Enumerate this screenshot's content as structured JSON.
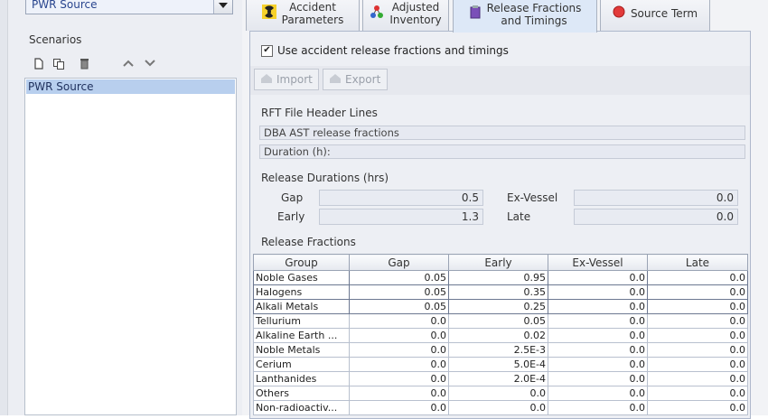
{
  "left_panel": {
    "source_select": "PWR Source",
    "scenarios_label": "Scenarios",
    "toolbar_icons": [
      "new-icon",
      "copy-icon",
      "delete-icon",
      "move-up-icon",
      "move-down-icon"
    ],
    "scenarios": [
      "PWR Source"
    ]
  },
  "tabs": [
    {
      "label": "Accident\nParameters",
      "icon": "radiation-icon",
      "active": false
    },
    {
      "label": "Adjusted\nInventory",
      "icon": "molecule-icon",
      "active": false
    },
    {
      "label": "Release Fractions\nand Timings",
      "icon": "flask-icon",
      "active": true
    },
    {
      "label": "Source Term",
      "icon": "red-circle-icon",
      "active": false
    }
  ],
  "release_panel": {
    "use_checkbox_label": "Use accident release fractions and timings",
    "use_checked": true,
    "import_label": "Import",
    "export_label": "Export",
    "rft_header_title": "RFT File Header Lines",
    "header_line1": "DBA AST release fractions",
    "header_line2": "Duration (h):",
    "durations_title": "Release Durations (hrs)",
    "durations": {
      "gap_label": "Gap",
      "gap_value": "0.5",
      "early_label": "Early",
      "early_value": "1.3",
      "exvessel_label": "Ex-Vessel",
      "exvessel_value": "0.0",
      "late_label": "Late",
      "late_value": "0.0"
    },
    "fractions_title": "Release Fractions",
    "table": {
      "columns": [
        "Group",
        "Gap",
        "Early",
        "Ex-Vessel",
        "Late"
      ],
      "rows": [
        [
          "Noble Gases",
          "0.05",
          "0.95",
          "0.0",
          "0.0"
        ],
        [
          "Halogens",
          "0.05",
          "0.35",
          "0.0",
          "0.0"
        ],
        [
          "Alkali Metals",
          "0.05",
          "0.25",
          "0.0",
          "0.0"
        ],
        [
          "Tellurium",
          "0.0",
          "0.05",
          "0.0",
          "0.0"
        ],
        [
          "Alkaline Earth ...",
          "0.0",
          "0.02",
          "0.0",
          "0.0"
        ],
        [
          "Noble Metals",
          "0.0",
          "2.5E-3",
          "0.0",
          "0.0"
        ],
        [
          "Cerium",
          "0.0",
          "5.0E-4",
          "0.0",
          "0.0"
        ],
        [
          "Lanthanides",
          "0.0",
          "2.0E-4",
          "0.0",
          "0.0"
        ],
        [
          "Others",
          "0.0",
          "0.0",
          "0.0",
          "0.0"
        ],
        [
          "Non-radioactiv...",
          "0.0",
          "0.0",
          "0.0",
          "0.0"
        ]
      ]
    }
  }
}
